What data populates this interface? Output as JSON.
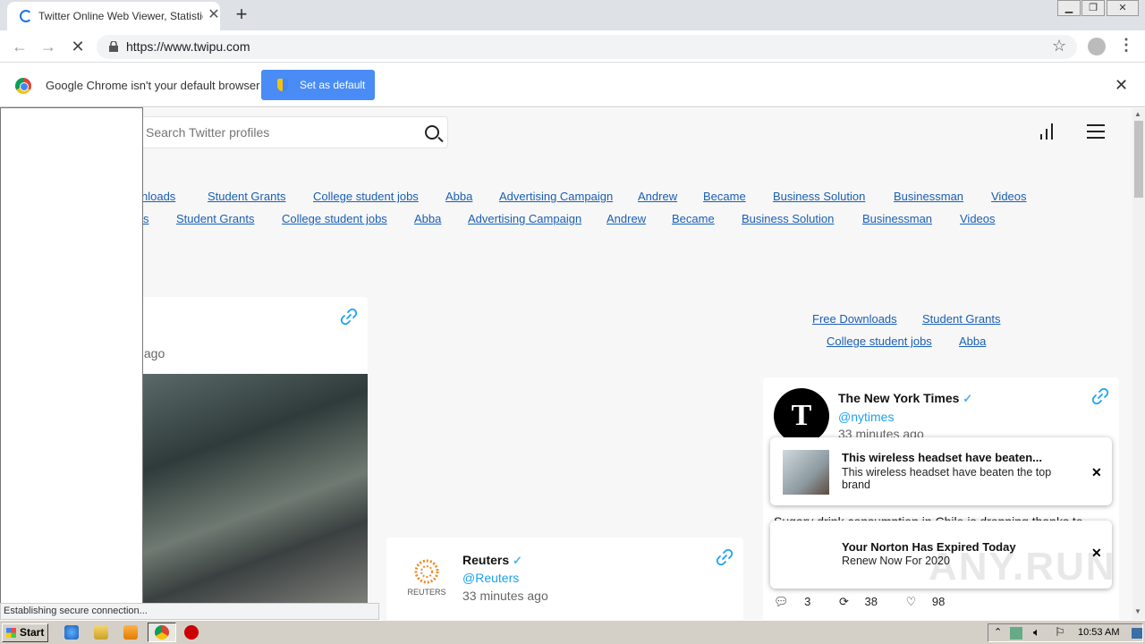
{
  "browser": {
    "tab_title": "Twitter Online Web Viewer, Statistic",
    "url": "https://www.twipu.com",
    "infobar_text": "Google Chrome isn't your default browser",
    "set_default_label": "Set as default"
  },
  "page": {
    "search_placeholder": "Search Twitter profiles",
    "link_row_1": [
      "nloads",
      "Student Grants",
      "College student jobs",
      "Abba",
      "Advertising Campaign",
      "Andrew",
      "Became",
      "Business Solution",
      "Businessman",
      "Videos"
    ],
    "link_row_2": [
      "s",
      "Student Grants",
      "College student jobs",
      "Abba",
      "Advertising Campaign",
      "Andrew",
      "Became",
      "Business Solution",
      "Businessman",
      "Videos"
    ],
    "side_links_1": [
      "Free Downloads",
      "Student Grants"
    ],
    "side_links_2": [
      "College student jobs",
      "Abba"
    ],
    "left_card_time": "s ago",
    "reuters": {
      "name": "Reuters",
      "handle": "@Reuters",
      "time": "33 minutes ago",
      "logo_text": "REUTERS"
    },
    "nyt": {
      "name": "The New York Times",
      "handle": "@nytimes",
      "time": "33 minutes ago",
      "text": "Sugary drink consumption in Chile is dropping thanks to sweeping food regulations that other countries have",
      "replies": "3",
      "retweets": "38",
      "likes": "98"
    }
  },
  "notifications": [
    {
      "title": "This wireless headset have beaten...",
      "body": "This wireless headset have beaten the top brand"
    },
    {
      "title": "Your Norton Has Expired Today",
      "body": "Renew Now For 2020"
    }
  ],
  "status_text": "Establishing secure connection...",
  "watermark": "ANY.RUN",
  "taskbar": {
    "start_label": "Start",
    "clock": "10:53 AM"
  }
}
